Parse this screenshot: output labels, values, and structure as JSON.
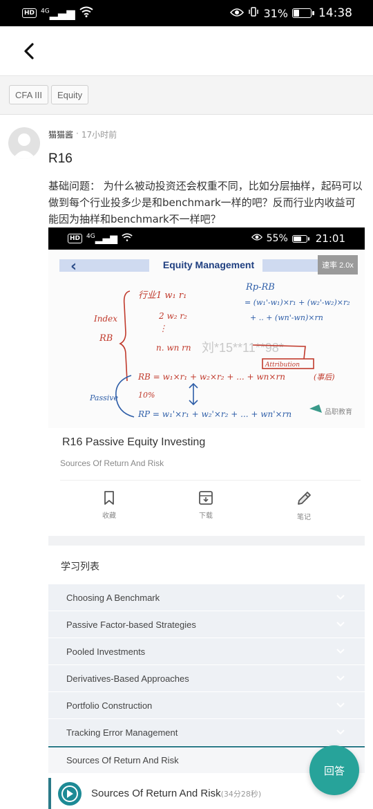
{
  "status_bar": {
    "network": "HD",
    "signal": "4G",
    "battery_percent": "31%",
    "battery_level": 0.31,
    "time": "14:38"
  },
  "tags": [
    "CFA III",
    "Equity"
  ],
  "post": {
    "author": "猫猫酱",
    "separator": "·",
    "time_ago": "17小时前",
    "title": "R16",
    "body": "基础问题： 为什么被动投资还会权重不同，比如分层抽样，起码可以做到每个行业投多少是和benchmark一样的吧？反而行业内收益可能因为抽样和benchmark不一样吧？"
  },
  "embedded_screenshot": {
    "status_bar": {
      "network": "HD",
      "signal": "4G",
      "battery_percent": "55%",
      "battery_level": 0.55,
      "time": "21:01"
    },
    "video": {
      "title": "Equity Management",
      "speed_label": "速率 2.0x",
      "watermark": "刘*15**11**98*",
      "logo_text": "品职教育",
      "handwriting": {
        "line1": "行业1  w₁  r₁",
        "index_label": "Index",
        "rb_label": "RB",
        "rp_minus_rb": "Rp-RB",
        "formula1": "= (w₁'-w₁)×r₁ + (w₂'-w₂)×r₂",
        "formula2": "+ .. + (wn'-wn)×rn",
        "attribution": "Attribution",
        "passive": "Passive",
        "percent": "10%",
        "rb_formula": "RB = w₁×r₁ + w₂×r₂ + ... + wn×rn",
        "rp_formula": "RP = w₁'×r₁ + w₂'×r₂ + ... + wn'×rn",
        "note": "(事后)"
      }
    },
    "lesson": {
      "title": "R16 Passive Equity Investing",
      "subtitle": "Sources Of Return And Risk"
    },
    "actions": [
      {
        "label": "收藏",
        "icon": "bookmark-icon"
      },
      {
        "label": "下载",
        "icon": "download-icon"
      },
      {
        "label": "笔记",
        "icon": "pencil-icon"
      }
    ],
    "list_header": "学习列表",
    "list_items": [
      "Choosing A Benchmark",
      "Passive Factor-based Strategies",
      "Pooled Investments",
      "Derivatives-Based Approaches",
      "Portfolio Construction",
      "Tracking Error Management"
    ],
    "active_section": "Sources Of Return And Risk",
    "playing": {
      "title": "Sources Of Return And Risk",
      "duration": "(34分28秒)"
    }
  },
  "fab": {
    "label": "回答"
  }
}
